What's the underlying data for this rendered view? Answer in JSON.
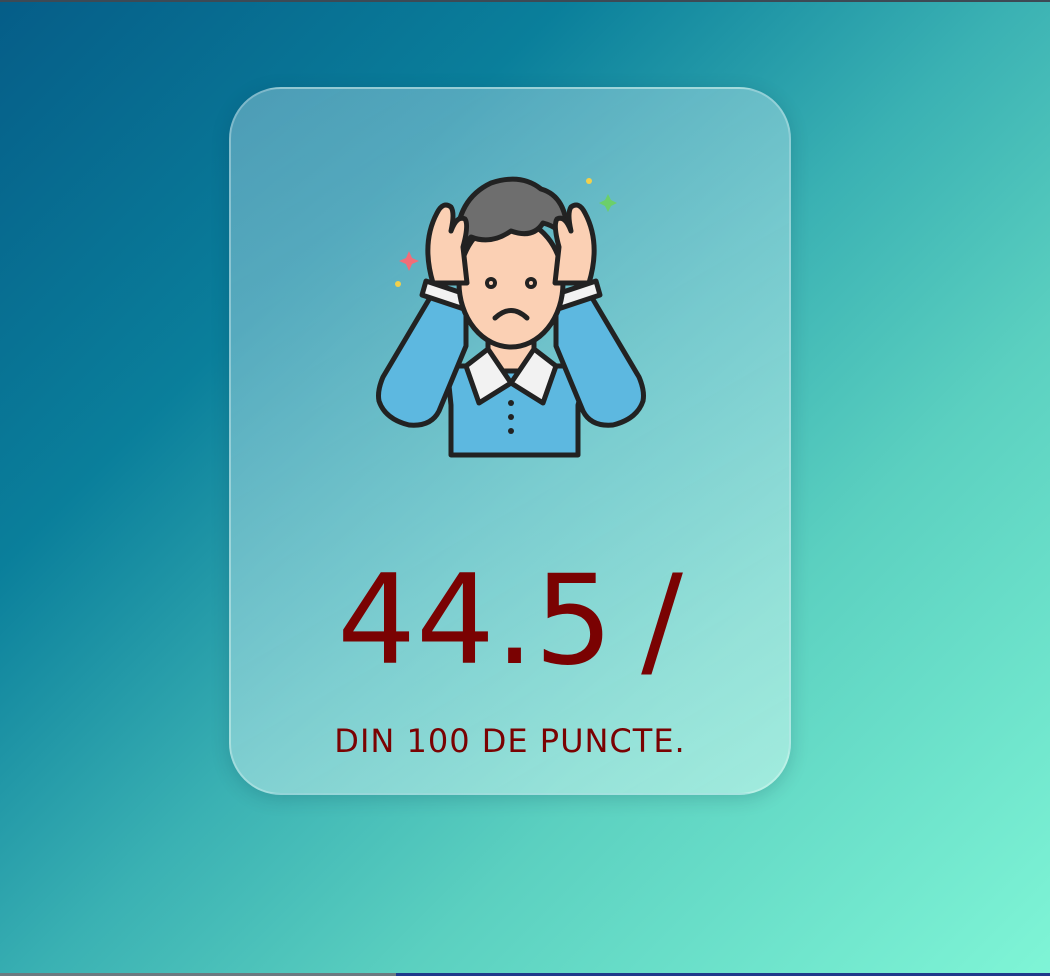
{
  "result": {
    "score": "44.5",
    "separator": "/",
    "subtitle": "DIN 100 DE PUNCTE."
  },
  "illustration": {
    "icon": "stressed-man-icon"
  },
  "colors": {
    "score_text": "#7a0202",
    "shirt": "#5db8e0",
    "hair": "#6e6e6e",
    "skin": "#fbd0b4",
    "background_start": "#055d88",
    "background_end": "#7ff5d6"
  }
}
